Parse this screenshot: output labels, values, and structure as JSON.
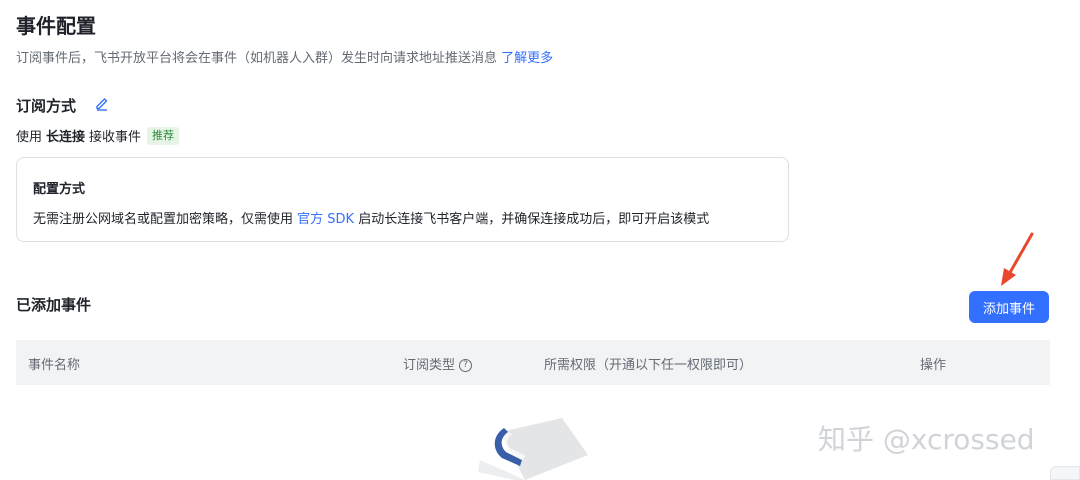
{
  "header": {
    "title": "事件配置",
    "description": "订阅事件后，飞书开放平台将会在事件（如机器人入群）发生时向请求地址推送消息",
    "learn_more": "了解更多"
  },
  "subscription": {
    "title": "订阅方式",
    "prefix": "使用",
    "method": "长连接",
    "suffix": "接收事件",
    "badge": "推荐"
  },
  "config_card": {
    "title": "配置方式",
    "text_before": "无需注册公网域名或配置加密策略，仅需使用",
    "link": "官方 SDK",
    "text_after": "启动长连接飞书客户端，并确保连接成功后，即可开启该模式"
  },
  "events": {
    "title": "已添加事件",
    "add_button": "添加事件",
    "columns": [
      "事件名称",
      "订阅类型",
      "所需权限（开通以下任一权限即可）",
      "操作"
    ]
  },
  "watermark": "知乎 @xcrossed",
  "colors": {
    "accent": "#3370ff",
    "arrow": "#e8492c",
    "badge_bg": "#e6f4e6",
    "badge_text": "#2e8b3a"
  }
}
